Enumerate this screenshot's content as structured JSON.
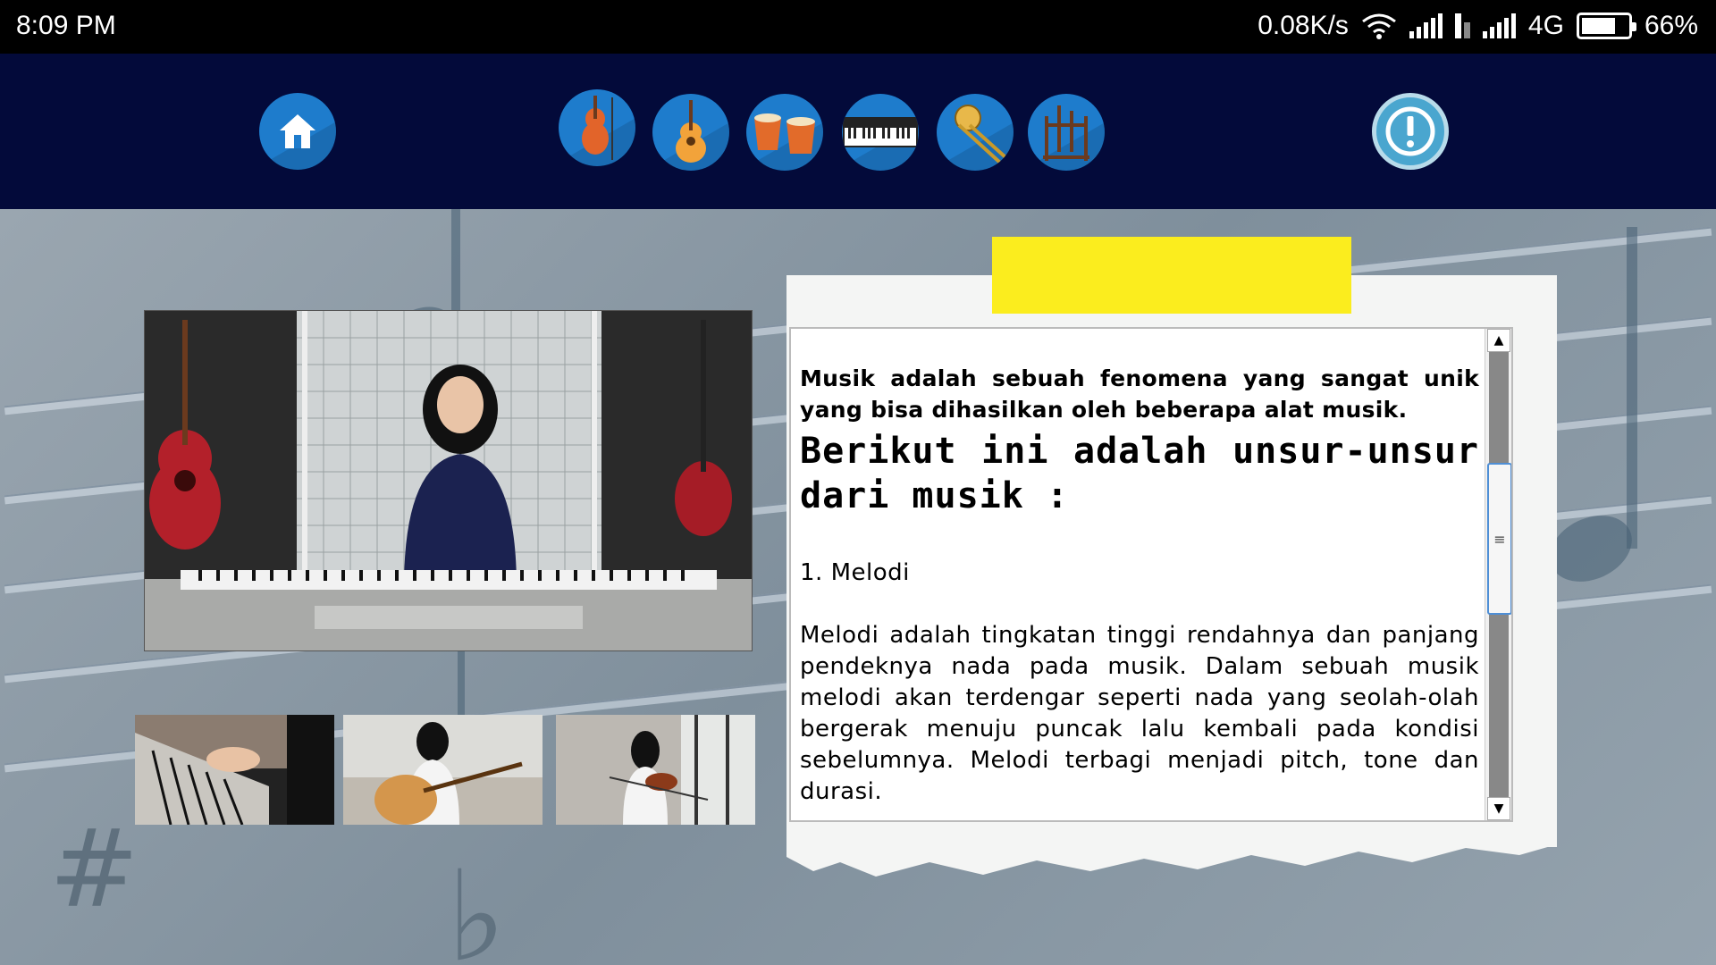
{
  "status_bar": {
    "time": "8:09 PM",
    "speed": "0.08K/s",
    "network": "4G",
    "battery": "66%",
    "battery_level": 0.66
  },
  "nav": {
    "home_icon": "home-icon",
    "instruments": [
      "violin-icon",
      "guitar-icon",
      "bongo-drums-icon",
      "piano-keyboard-icon",
      "trombone-icon",
      "angklung-icon"
    ],
    "info_icon": "exclamation-icon",
    "colors": {
      "bar": "#030a3a",
      "button": "#1e7ccc"
    }
  },
  "text_panel": {
    "paragraph1": "Musik adalah sebuah fenomena yang sangat unik yang bisa dihasilkan oleh beberapa alat musik.",
    "heading": "Berikut ini adalah unsur-unsur dari musik :",
    "item1": "1. Melodi",
    "paragraph2": "Melodi adalah tingkatan tinggi rendahnya dan panjang pendeknya nada pada musik. Dalam sebuah musik melodi akan terdengar seperti nada yang seolah-olah bergerak menuju puncak lalu kembali pada kondisi sebelumnya. Melodi terbagi menjadi pitch, tone dan durasi.",
    "scroll_up": "▲",
    "scroll_down": "▼",
    "scroll_grip": "≡",
    "tape_color": "#fbed1e"
  }
}
